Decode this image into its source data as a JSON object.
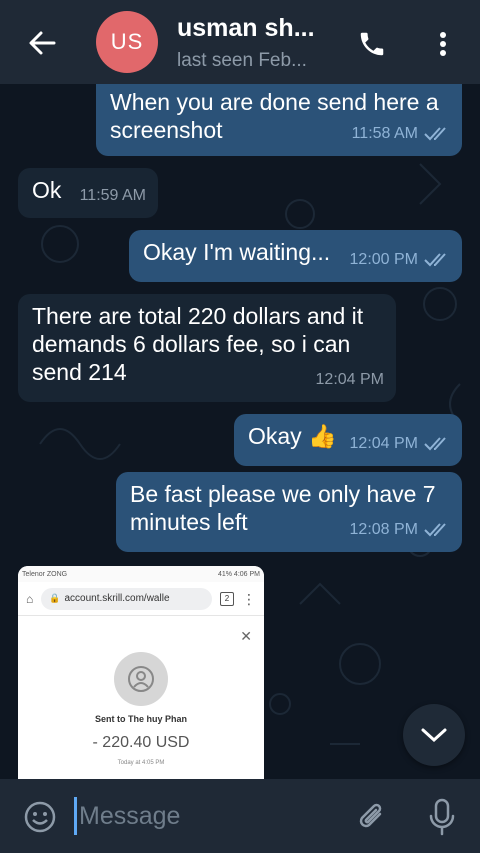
{
  "header": {
    "avatar_initials": "US",
    "avatar_color": "#e1686b",
    "title": "usman sh...",
    "status": "last seen Feb..."
  },
  "messages": [
    {
      "direction": "out",
      "text": "When you are done send here a screenshot",
      "time": "11:58 AM",
      "read": true
    },
    {
      "direction": "in",
      "text": "Ok",
      "time": "11:59 AM"
    },
    {
      "direction": "out",
      "text": "Okay I'm waiting...",
      "time": "12:00 PM",
      "read": true
    },
    {
      "direction": "in",
      "text": "There are total 220 dollars and it demands 6 dollars fee, so i can send 214",
      "time": "12:04 PM"
    },
    {
      "direction": "out",
      "text": "Okay",
      "emoji": "👍",
      "time": "12:04 PM",
      "read": true
    },
    {
      "direction": "out",
      "text": "Be fast please we only have 7 minutes left",
      "time": "12:08 PM",
      "read": true
    }
  ],
  "photo": {
    "status_left": "Telenor ZONG",
    "status_right": "41% 4:06 PM",
    "url": "account.skrill.com/walle",
    "tabs_count": "2",
    "sent_to": "Sent to The huy Phan",
    "amount": "- 220.40 USD",
    "timestamp": "Today at 4:05 PM"
  },
  "input": {
    "placeholder": "Message"
  },
  "colors": {
    "header_bg": "#1f2936",
    "chat_bg": "#0e1621",
    "outgoing_bubble": "#2b5278",
    "incoming_bubble": "#182533",
    "accent": "#5fa9f5"
  },
  "icons": {
    "back": "arrow-left-icon",
    "call": "phone-icon",
    "menu": "more-vertical-icon",
    "emoji": "smile-icon",
    "attach": "paperclip-icon",
    "mic": "microphone-icon",
    "scroll": "chevron-down-icon"
  }
}
